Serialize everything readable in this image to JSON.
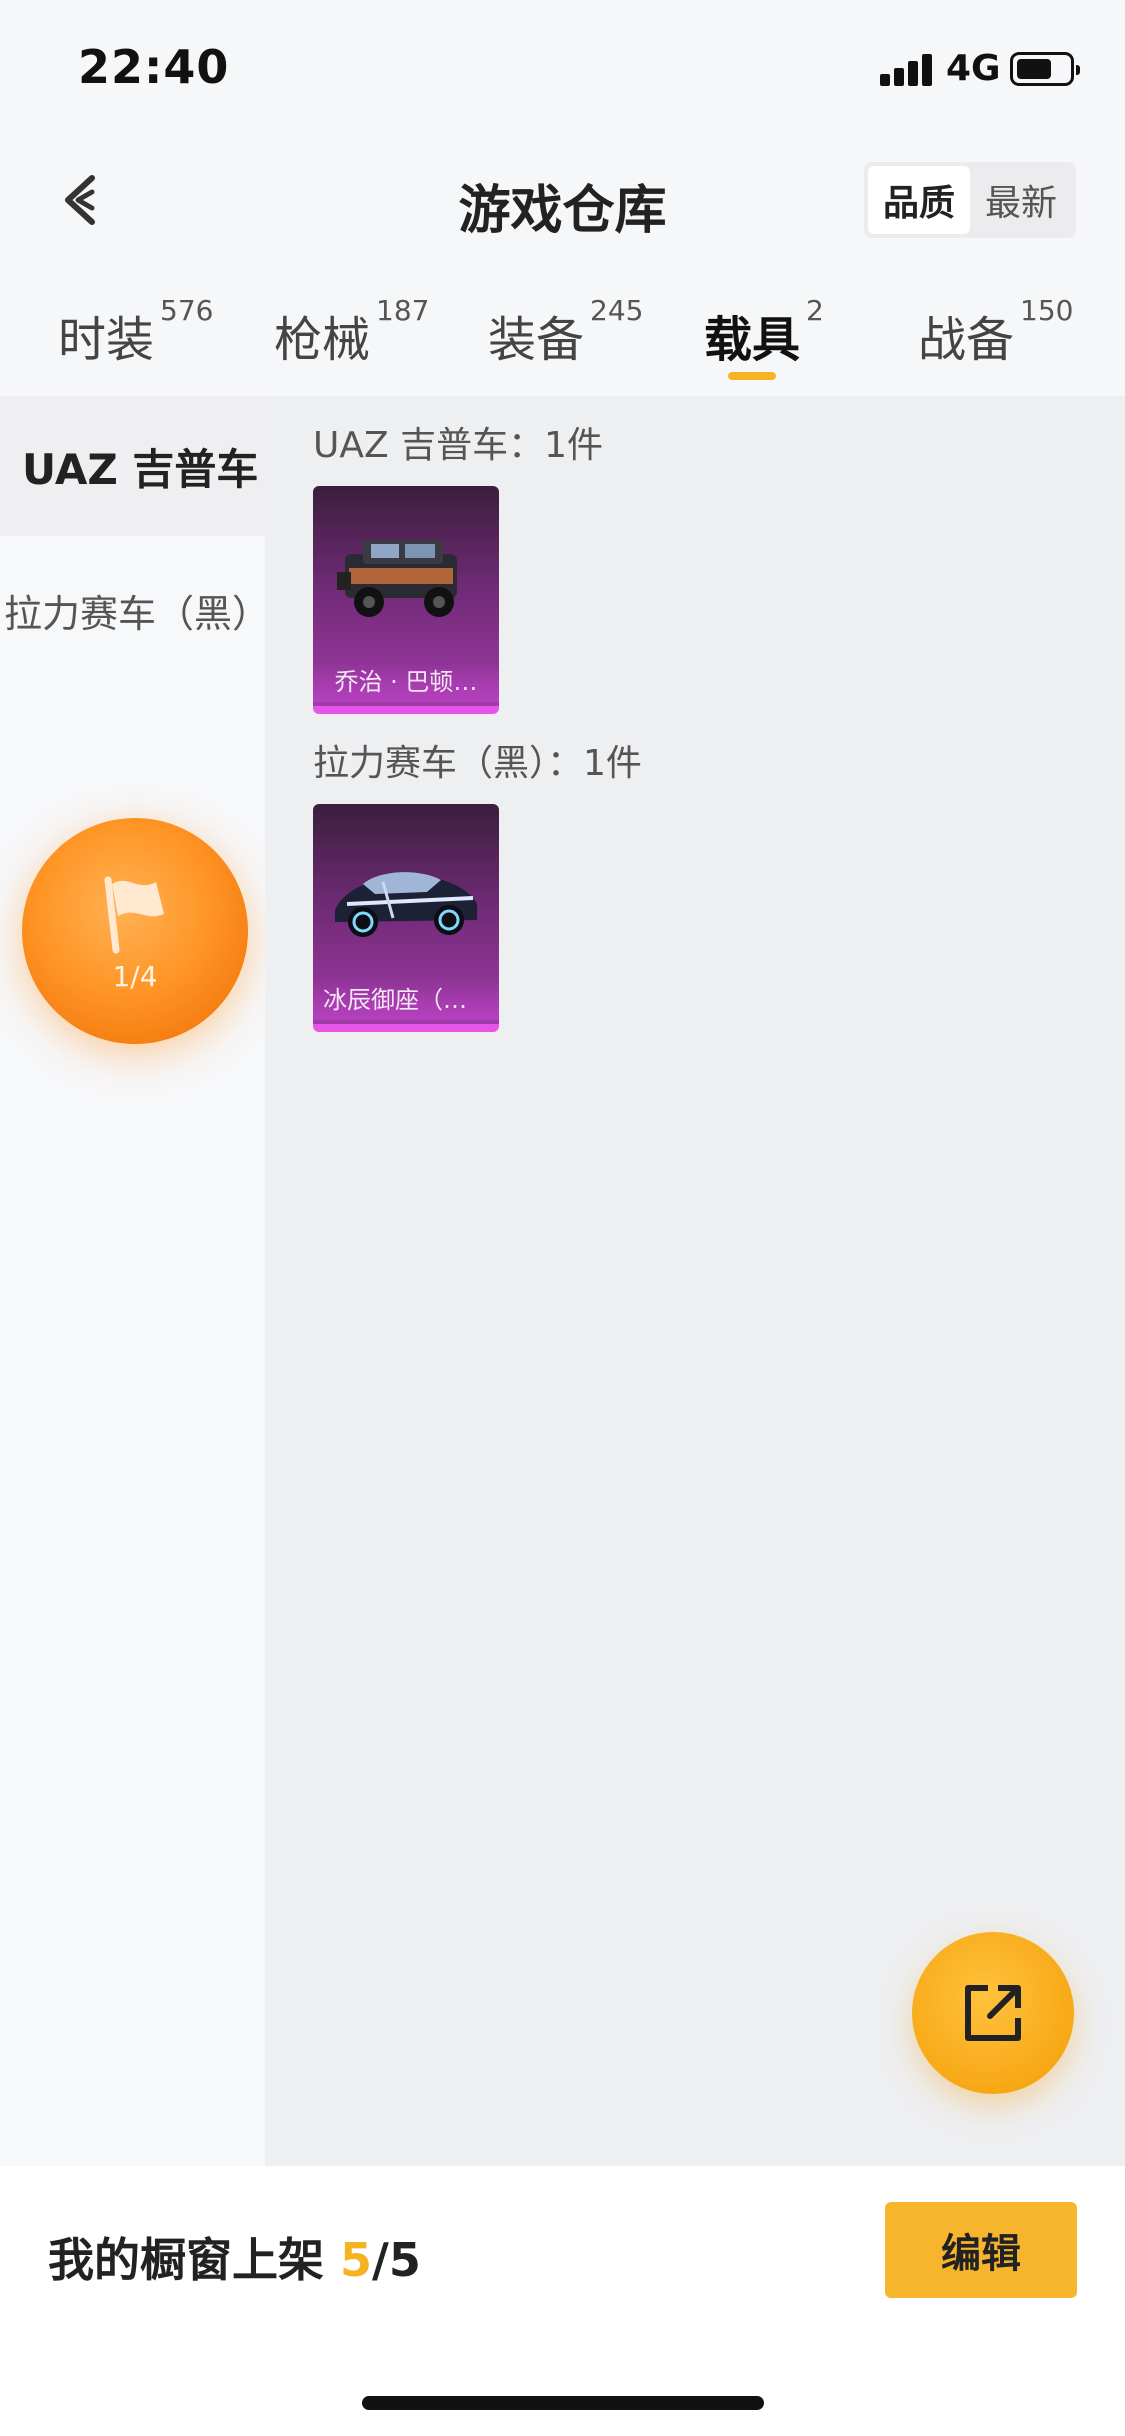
{
  "status_bar": {
    "time": "22:40",
    "network": "4G"
  },
  "header": {
    "title": "游戏仓库",
    "sort_options": [
      "品质",
      "最新"
    ],
    "active_sort": "品质"
  },
  "tabs": [
    {
      "label": "时装",
      "count": "576"
    },
    {
      "label": "枪械",
      "count": "187"
    },
    {
      "label": "装备",
      "count": "245"
    },
    {
      "label": "载具",
      "count": "2"
    },
    {
      "label": "战备",
      "count": "150"
    }
  ],
  "side_nav": {
    "items": [
      "UAZ 吉普车",
      "拉力赛车（黑）"
    ],
    "progress": "1/4"
  },
  "groups": [
    {
      "title": "UAZ 吉普车：1件",
      "item_name": "乔治 · 巴顿…"
    },
    {
      "title": "拉力赛车（黑）：1件",
      "item_name": "冰辰御座（神…"
    }
  ],
  "bottom": {
    "shelf_label": "我的橱窗上架 ",
    "shelf_current": "5",
    "shelf_total": "/5",
    "edit_label": "编辑"
  },
  "colors": {
    "accent": "#f5b324",
    "card_purple": "#a03aa8"
  }
}
